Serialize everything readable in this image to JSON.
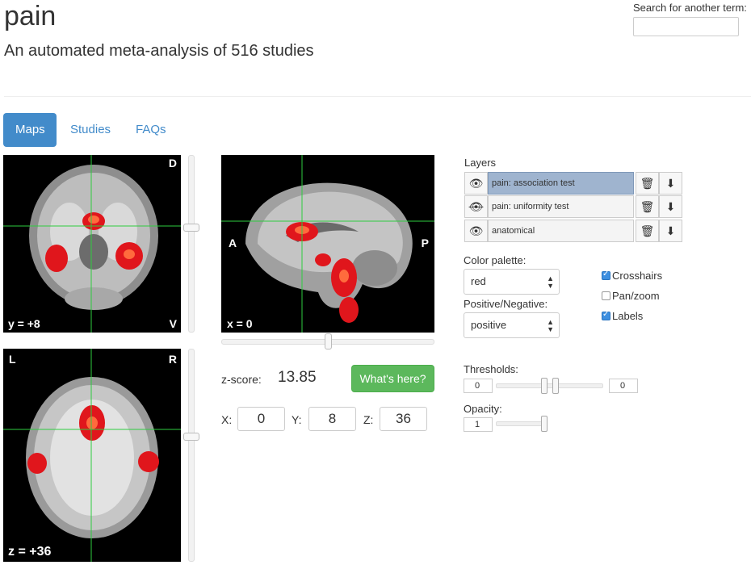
{
  "header": {
    "term": "pain",
    "subtitle": "An automated meta-analysis of 516 studies",
    "search_label": "Search for another term:",
    "search_value": ""
  },
  "tabs": [
    {
      "label": "Maps",
      "active": true
    },
    {
      "label": "Studies",
      "active": false
    },
    {
      "label": "FAQs",
      "active": false
    }
  ],
  "views": {
    "coronal": {
      "corner_top_right": "D",
      "corner_bottom_right": "V",
      "slice_label": "y = +8"
    },
    "sagittal": {
      "side_left": "A",
      "side_right": "P",
      "slice_label": "x = 0"
    },
    "axial": {
      "corner_top_left": "L",
      "corner_top_right": "R",
      "slice_label": "z = +36"
    }
  },
  "readout": {
    "zscore_label": "z-score:",
    "zscore_value": "13.85",
    "whats_here_label": "What's here?",
    "x_label": "X:",
    "x_value": "0",
    "y_label": "Y:",
    "y_value": "8",
    "z_label": "Z:",
    "z_value": "36"
  },
  "layers": {
    "title": "Layers",
    "items": [
      {
        "name": "pain: association test",
        "visible": true,
        "selected": true
      },
      {
        "name": "pain: uniformity test",
        "visible": false,
        "selected": false
      },
      {
        "name": "anatomical",
        "visible": true,
        "selected": false
      }
    ]
  },
  "controls": {
    "color_palette_label": "Color palette:",
    "color_palette_value": "red",
    "posneg_label": "Positive/Negative:",
    "posneg_value": "positive",
    "crosshairs_label": "Crosshairs",
    "crosshairs_checked": true,
    "panzoom_label": "Pan/zoom",
    "panzoom_checked": false,
    "labels_label": "Labels",
    "labels_checked": true,
    "thresholds_label": "Thresholds:",
    "threshold_low": "0",
    "threshold_high": "0",
    "opacity_label": "Opacity:",
    "opacity_value": "1"
  },
  "colors": {
    "tab_active": "#428bca",
    "whats_here_button": "#5cb85c",
    "crosshair": "#2ecc40",
    "activation": "#e0161c",
    "layer_selected": "#9fb4cf"
  },
  "icons": {
    "eye": "eye-icon",
    "eye_hidden": "eye-slash-icon",
    "trash": "trash-icon",
    "download": "download-icon"
  }
}
